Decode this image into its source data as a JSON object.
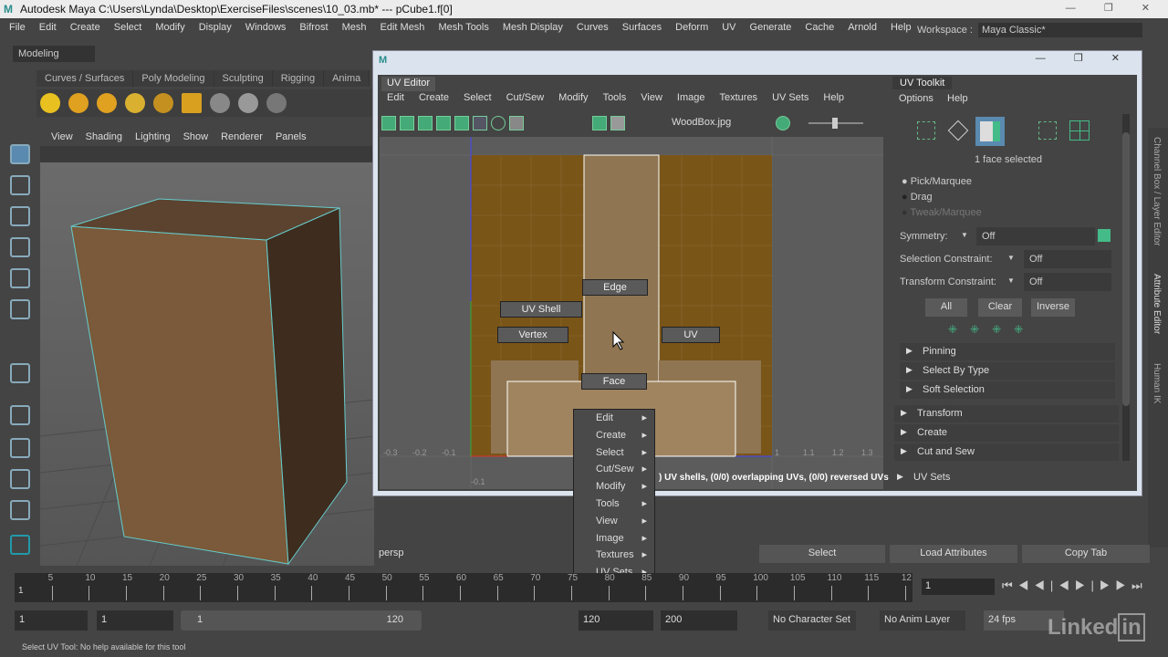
{
  "window": {
    "title": "Autodesk Maya  C:\\Users\\Lynda\\Desktop\\ExerciseFiles\\scenes\\10_03.mb*   ---   pCube1.f[0]",
    "logo": "M"
  },
  "menubar": [
    "File",
    "Edit",
    "Create",
    "Select",
    "Modify",
    "Display",
    "Windows",
    "Bifrost",
    "Mesh",
    "Edit Mesh",
    "Mesh Tools",
    "Mesh Display",
    "Curves",
    "Surfaces",
    "Deform",
    "UV",
    "Generate",
    "Cache",
    "Arnold",
    "Help"
  ],
  "workspace": {
    "label": "Workspace :",
    "value": "Maya Classic*"
  },
  "mode_menu": "Modeling",
  "shelf_tabs": [
    "Curves / Surfaces",
    "Poly Modeling",
    "Sculpting",
    "Rigging",
    "Anima"
  ],
  "viewport": {
    "menu": [
      "View",
      "Shading",
      "Lighting",
      "Show",
      "Renderer",
      "Panels"
    ],
    "camera": "persp"
  },
  "uv_editor": {
    "title": "UV Editor",
    "menu": [
      "Edit",
      "Create",
      "Select",
      "Cut/Sew",
      "Modify",
      "Tools",
      "View",
      "Image",
      "Textures",
      "UV Sets",
      "Help"
    ],
    "texture": "WoodBox.jpg",
    "axis_x": [
      "-0.3",
      "-0.2",
      "-0.1",
      "1",
      "1.1",
      "1.2",
      "1.3"
    ],
    "axis_y": "-0.1",
    "status": ") UV shells, (0/0) overlapping UVs, (0/0) reversed UVs",
    "marking_menu": {
      "edge": "Edge",
      "uv_shell": "UV Shell",
      "vertex": "Vertex",
      "uv": "UV",
      "face": "Face"
    },
    "context_menu": [
      "Edit",
      "Create",
      "Select",
      "Cut/Sew",
      "Modify",
      "Tools",
      "View",
      "Image",
      "Textures",
      "UV Sets"
    ]
  },
  "uv_toolkit": {
    "title": "UV Toolkit",
    "menu": [
      "Options",
      "Help"
    ],
    "selection": "1 face selected",
    "modes": [
      "Pick/Marquee",
      "Drag",
      "Tweak/Marquee"
    ],
    "symmetry": {
      "label": "Symmetry:",
      "value": "Off"
    },
    "selection_constraint": {
      "label": "Selection Constraint:",
      "value": "Off"
    },
    "transform_constraint": {
      "label": "Transform Constraint:",
      "value": "Off"
    },
    "buttons": [
      "All",
      "Clear",
      "Inverse"
    ],
    "sections": [
      "Pinning",
      "Select By Type",
      "Soft Selection",
      "Transform",
      "Create",
      "Cut and Sew",
      "UV Sets"
    ]
  },
  "side_tabs": [
    "Channel Box / Layer Editor",
    "Attribute Editor",
    "Human IK"
  ],
  "attr_buttons": [
    "Select",
    "Load Attributes",
    "Copy Tab"
  ],
  "timeline": {
    "ticks": [
      "5",
      "10",
      "15",
      "20",
      "25",
      "30",
      "35",
      "40",
      "45",
      "50",
      "55",
      "60",
      "65",
      "70",
      "75",
      "80",
      "85",
      "90",
      "95",
      "100",
      "105",
      "110",
      "115",
      "12"
    ],
    "start": "1",
    "current": "1"
  },
  "range": {
    "start": "1",
    "anim_start": "1",
    "range_start": "1",
    "range_end": "120",
    "end": "120",
    "anim_end": "200",
    "character_set": "No Character Set",
    "anim_layer": "No Anim Layer",
    "fps": "24 fps"
  },
  "status_line": "Select UV Tool: No help available for this tool",
  "watermark": "LinkedIn"
}
